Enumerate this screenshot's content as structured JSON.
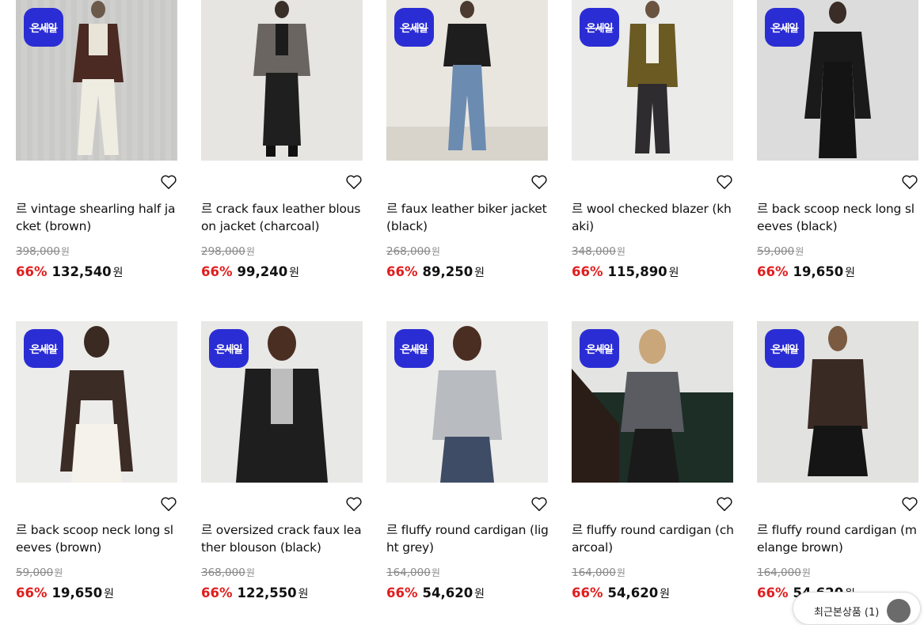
{
  "badge_label": "온세일",
  "currency": "원",
  "products": [
    {
      "title": "르 vintage shearling half jacket (brown)",
      "original_price": "398,000",
      "discount": "66%",
      "sale_price": "132,540"
    },
    {
      "title": "르 crack faux leather blouson jacket (charcoal)",
      "original_price": "298,000",
      "discount": "66%",
      "sale_price": "99,240"
    },
    {
      "title": "르 faux leather biker jacket (black)",
      "original_price": "268,000",
      "discount": "66%",
      "sale_price": "89,250"
    },
    {
      "title": "르 wool checked blazer (khaki)",
      "original_price": "348,000",
      "discount": "66%",
      "sale_price": "115,890"
    },
    {
      "title": "르 back scoop neck long sleeves (black)",
      "original_price": "59,000",
      "discount": "66%",
      "sale_price": "19,650"
    },
    {
      "title": "르 back scoop neck long sleeves (brown)",
      "original_price": "59,000",
      "discount": "66%",
      "sale_price": "19,650"
    },
    {
      "title": "르 oversized crack faux leather blouson (black)",
      "original_price": "368,000",
      "discount": "66%",
      "sale_price": "122,550"
    },
    {
      "title": "르 fluffy round cardigan (light grey)",
      "original_price": "164,000",
      "discount": "66%",
      "sale_price": "54,620"
    },
    {
      "title": "르 fluffy round cardigan (charcoal)",
      "original_price": "164,000",
      "discount": "66%",
      "sale_price": "54,620"
    },
    {
      "title": "르 fluffy round cardigan (melange brown)",
      "original_price": "164,000",
      "discount": "66%",
      "sale_price": "54,620"
    }
  ],
  "recent_products": {
    "label": "최근본상품 (1)"
  }
}
